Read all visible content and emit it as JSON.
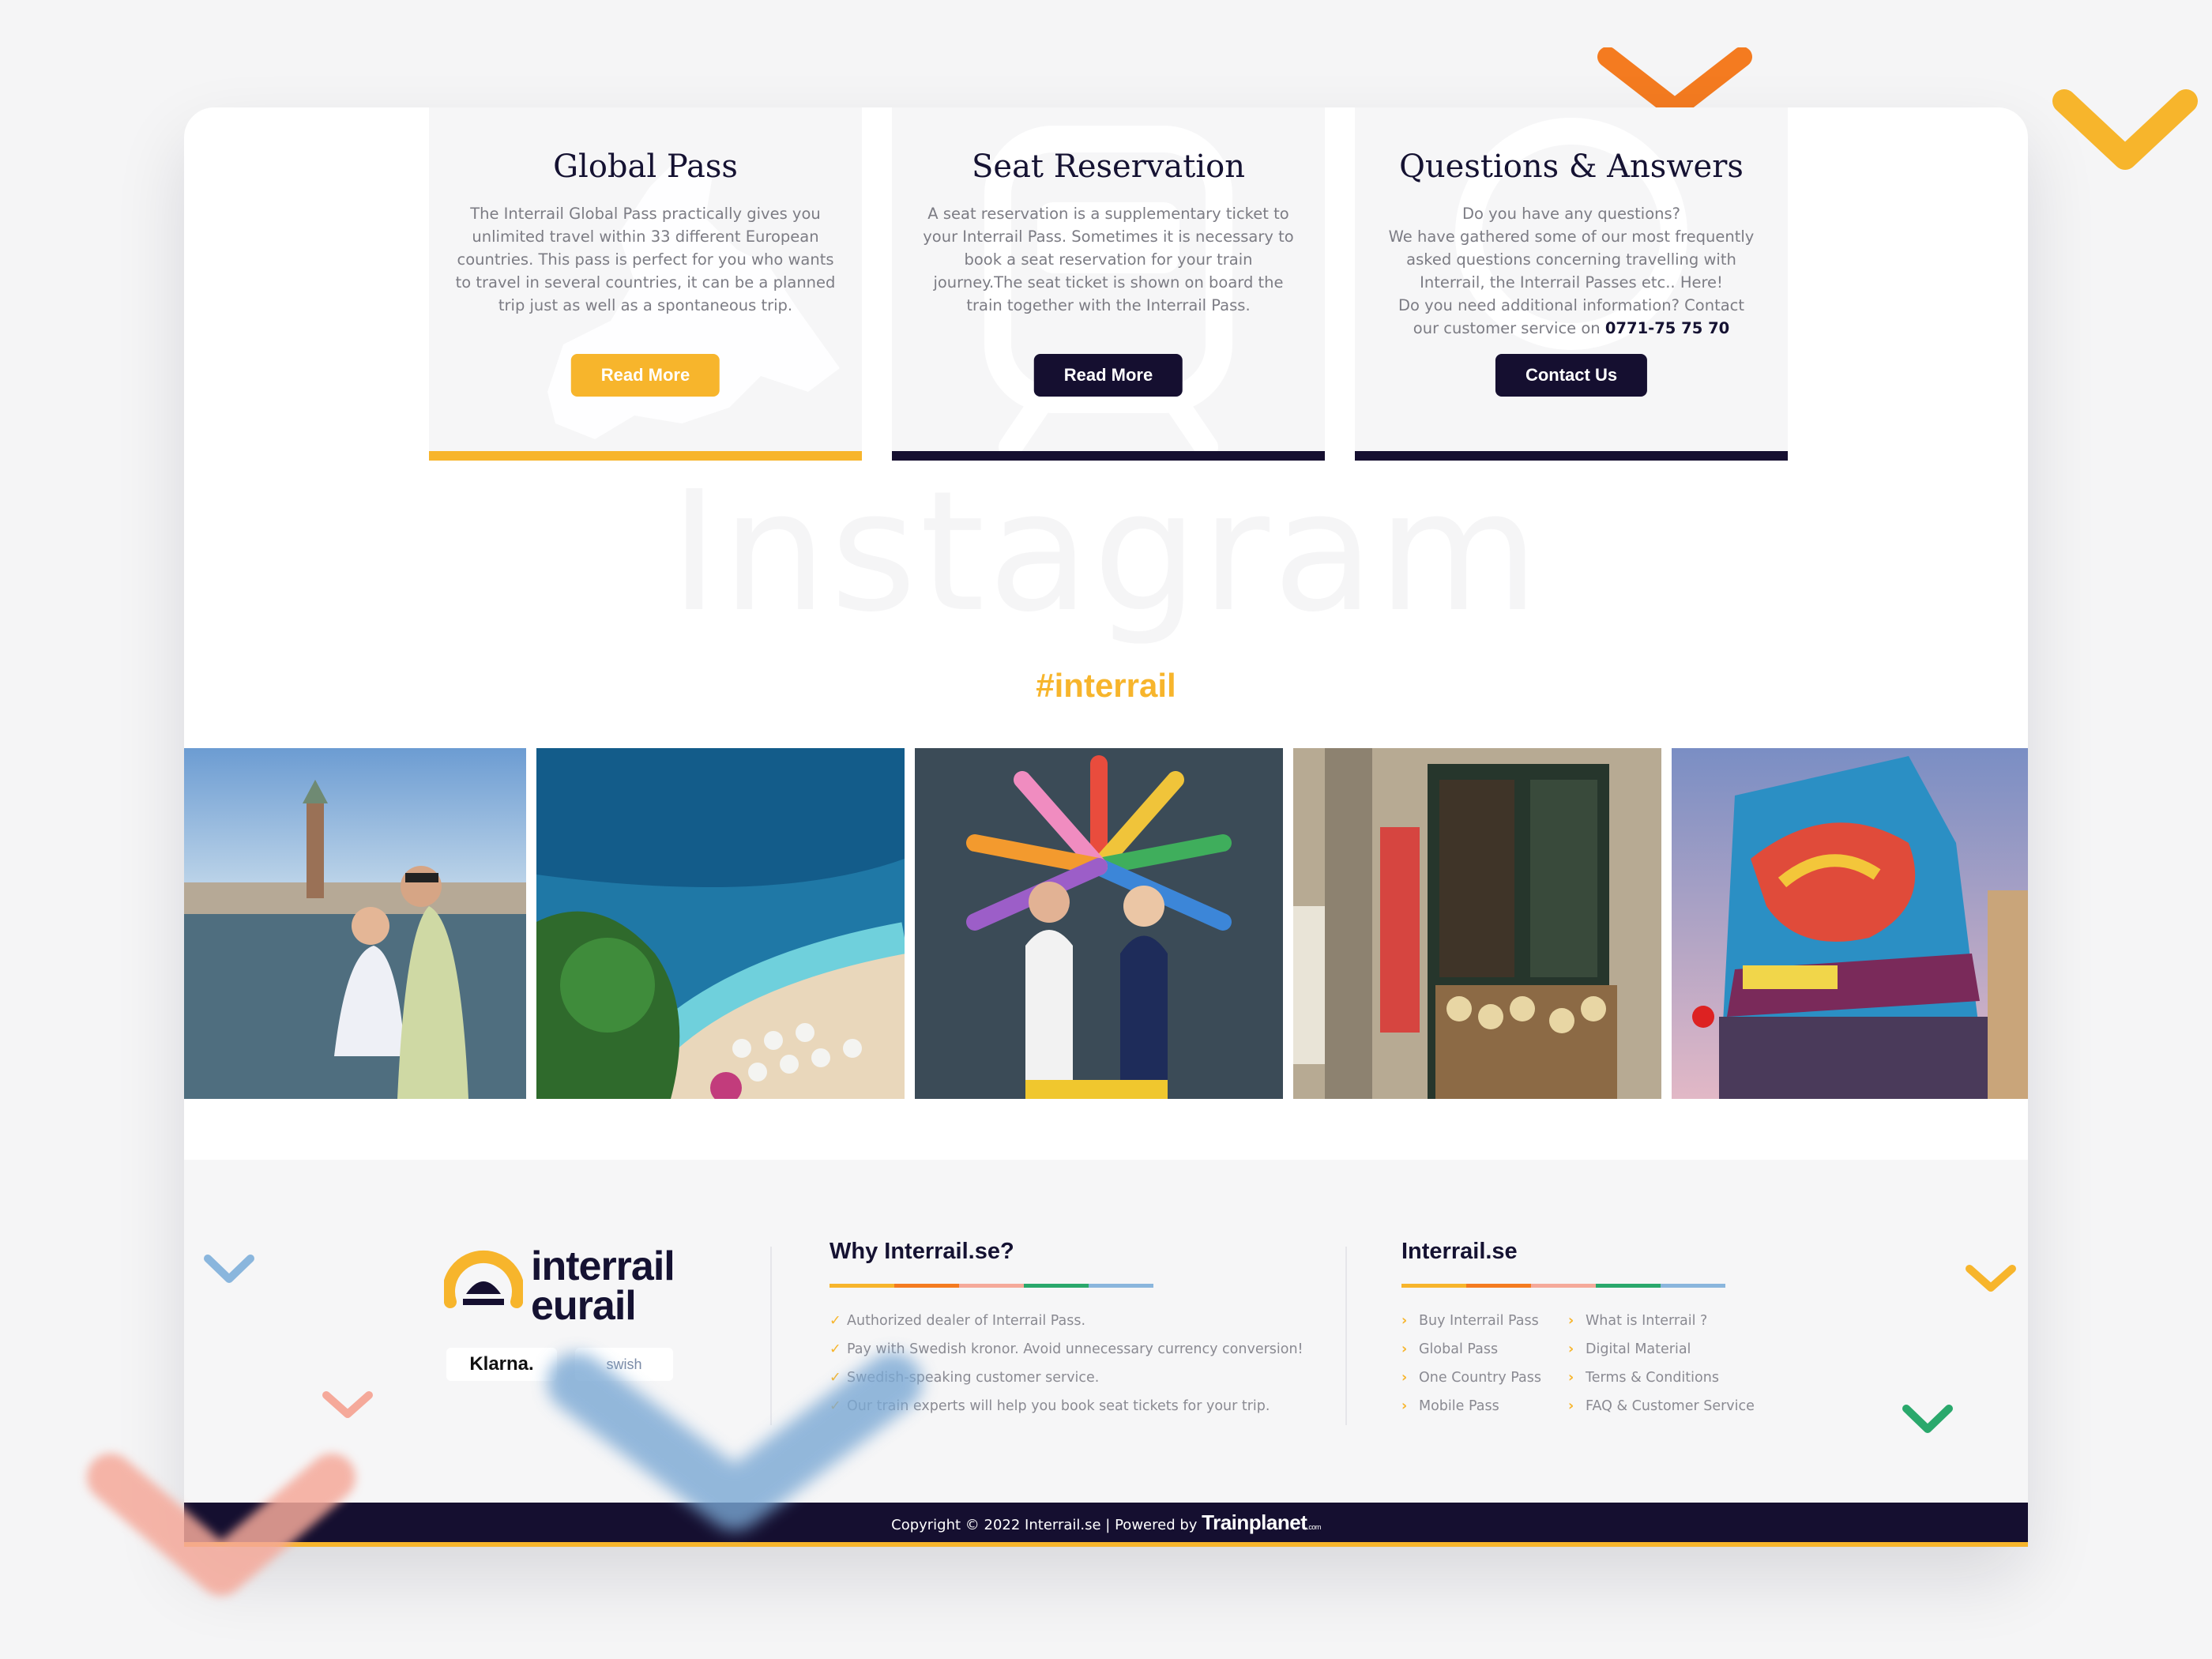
{
  "colors": {
    "accent_yellow": "#f7b52c",
    "navy": "#150f30",
    "orange": "#f47b20",
    "pink": "#f5a99a",
    "green": "#2aa86c",
    "blue": "#8ab6dd"
  },
  "cards": [
    {
      "title": "Global Pass",
      "body": "The Interrail Global Pass practically gives you\nunlimited travel within 33 different European\ncountries. This pass is perfect for you who wants\nto travel in several countries, it can be a planned\ntrip just as well as a spontaneous trip.",
      "button": "Read More",
      "watermark_icon": "europe-map-icon"
    },
    {
      "title": "Seat Reservation",
      "body": "A seat reservation is a supplementary ticket to\nyour Interrail Pass. Sometimes it is necessary to\nbook a seat reservation for your train\njourney.The seat ticket is shown on board the\ntrain together with the Interrail Pass.",
      "button": "Read More",
      "watermark_icon": "train-icon"
    },
    {
      "title": "Questions & Answers",
      "body_lines": [
        "Do you have any questions?",
        "We have gathered some of our most frequently",
        "asked questions concerning travelling with",
        "Interrail, the Interrail Passes etc.. Here!",
        "Do you need additional information? Contact"
      ],
      "body_last_prefix": "our customer service on ",
      "phone": "0771-75 75 70",
      "button": "Contact Us",
      "watermark_icon": "question-bubble-icon"
    }
  ],
  "instagram": {
    "watermark": "Instagram",
    "hashtag": "#interrail"
  },
  "photos": [
    {
      "icon": "venice-couple-photo"
    },
    {
      "icon": "beach-coast-photo"
    },
    {
      "icon": "clog-wall-couple-photo"
    },
    {
      "icon": "shop-front-photo"
    },
    {
      "icon": "mural-building-photo"
    }
  ],
  "footer": {
    "logo_line1": "interrail",
    "logo_line2": "eurail",
    "payments": [
      "Klarna.",
      "swish"
    ],
    "why": {
      "heading": "Why Interrail.se?",
      "items": [
        "Authorized dealer of Interrail Pass.",
        "Pay with Swedish kronor. Avoid unnecessary currency conversion!",
        "Swedish-speaking customer service.",
        "Our train experts will help you book seat tickets for your trip."
      ]
    },
    "links": {
      "heading": "Interrail.se",
      "col1": [
        "Buy Interrail Pass",
        "Global Pass",
        "One Country Pass",
        "Mobile Pass"
      ],
      "col2": [
        "What is Interrail ?",
        "Digital Material",
        "Terms & Conditions",
        "FAQ & Customer Service"
      ]
    },
    "copyright": "Copyright © 2022 Interrail.se |  Powered by ",
    "powered_brand": "Trainplanet",
    "powered_suffix": ".com"
  }
}
